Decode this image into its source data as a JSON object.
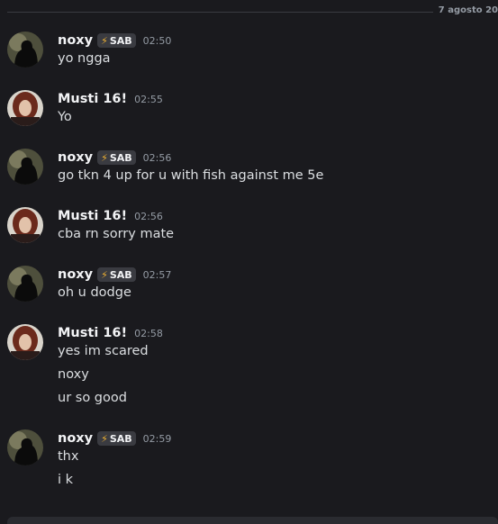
{
  "date_divider": "7 agosto 20",
  "users": {
    "noxy": {
      "name": "noxy",
      "tag": "SAB",
      "tag_icon": "lightning-bolt-icon"
    },
    "musti": {
      "name": "Musti 16!"
    }
  },
  "messages": [
    {
      "author": "noxy",
      "time": "02:50",
      "lines": [
        "yo ngga"
      ]
    },
    {
      "author": "Musti 16!",
      "time": "02:55",
      "lines": [
        "Yo"
      ]
    },
    {
      "author": "noxy",
      "time": "02:56",
      "lines": [
        "go tkn 4 up for u with fish against me 5e"
      ]
    },
    {
      "author": "Musti 16!",
      "time": "02:56",
      "lines": [
        "cba rn sorry mate"
      ]
    },
    {
      "author": "noxy",
      "time": "02:57",
      "lines": [
        "oh u dodge"
      ]
    },
    {
      "author": "Musti 16!",
      "time": "02:58",
      "lines": [
        "yes im scared",
        "noxy",
        "ur so good"
      ]
    },
    {
      "author": "noxy",
      "time": "02:59",
      "lines": [
        "thx",
        "i k"
      ]
    }
  ],
  "colors": {
    "background": "#1a1a1e",
    "username": "#f2f3f5",
    "text": "#dbdee1",
    "timestamp": "#949ba4",
    "tag_bg": "#3a3b41",
    "bolt": "#f0b232"
  }
}
